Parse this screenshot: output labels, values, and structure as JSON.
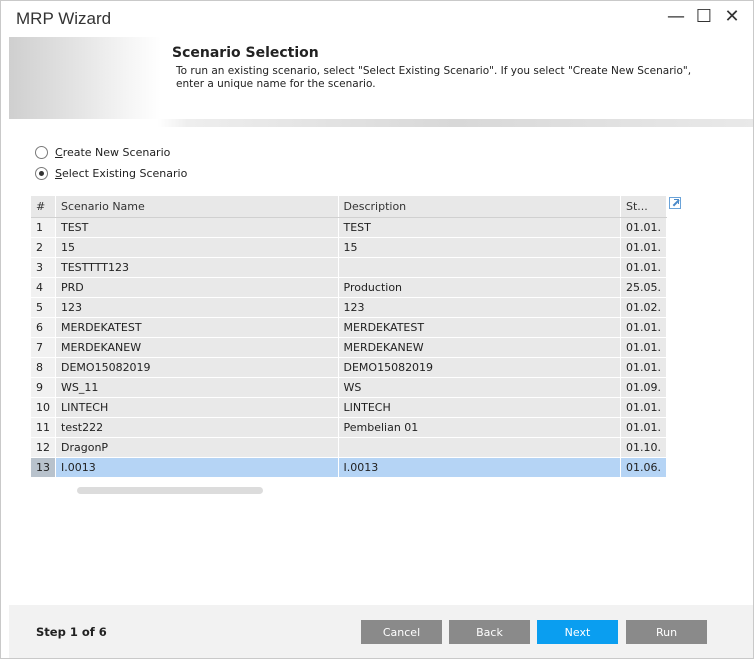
{
  "window": {
    "title": "MRP Wizard",
    "controls": {
      "minimize": "—",
      "maximize": "☐",
      "close": "✕"
    }
  },
  "header": {
    "title": "Scenario Selection",
    "description": "To run an existing scenario, select \"Select Existing Scenario\". If you select \"Create New Scenario\", enter a unique name for the scenario."
  },
  "options": {
    "create_new": {
      "label": "Create New Scenario",
      "checked": false
    },
    "select_existing": {
      "label": "Select Existing Scenario",
      "checked": true
    }
  },
  "grid": {
    "columns": [
      "#",
      "Scenario Name",
      "Description",
      "St..."
    ],
    "rows": [
      {
        "num": "1",
        "name": "TEST",
        "description": "TEST",
        "st": "01.01."
      },
      {
        "num": "2",
        "name": "15",
        "description": "15",
        "st": "01.01."
      },
      {
        "num": "3",
        "name": "TESTTTT123",
        "description": "",
        "st": "01.01."
      },
      {
        "num": "4",
        "name": "PRD",
        "description": "Production",
        "st": "25.05."
      },
      {
        "num": "5",
        "name": "123",
        "description": "123",
        "st": "01.02."
      },
      {
        "num": "6",
        "name": "MERDEKATEST",
        "description": "MERDEKATEST",
        "st": "01.01."
      },
      {
        "num": "7",
        "name": "MERDEKANEW",
        "description": "MERDEKANEW",
        "st": "01.01."
      },
      {
        "num": "8",
        "name": "DEMO15082019",
        "description": "DEMO15082019",
        "st": "01.01."
      },
      {
        "num": "9",
        "name": "WS_11",
        "description": "WS",
        "st": "01.09."
      },
      {
        "num": "10",
        "name": "LINTECH",
        "description": "LINTECH",
        "st": "01.01."
      },
      {
        "num": "11",
        "name": "test222",
        "description": "Pembelian 01",
        "st": "01.01."
      },
      {
        "num": "12",
        "name": "DragonP",
        "description": "",
        "st": "01.10."
      },
      {
        "num": "13",
        "name": "I.0013",
        "description": "I.0013",
        "st": "01.06."
      }
    ],
    "selected_row": "13"
  },
  "footer": {
    "step": "Step 1 of 6",
    "buttons": {
      "cancel": "Cancel",
      "back": "Back",
      "next": "Next",
      "run": "Run"
    }
  },
  "colors": {
    "accent": "#0a9ef0",
    "button_gray": "#8a8a8a",
    "selected_row": "#b5d4f5"
  }
}
